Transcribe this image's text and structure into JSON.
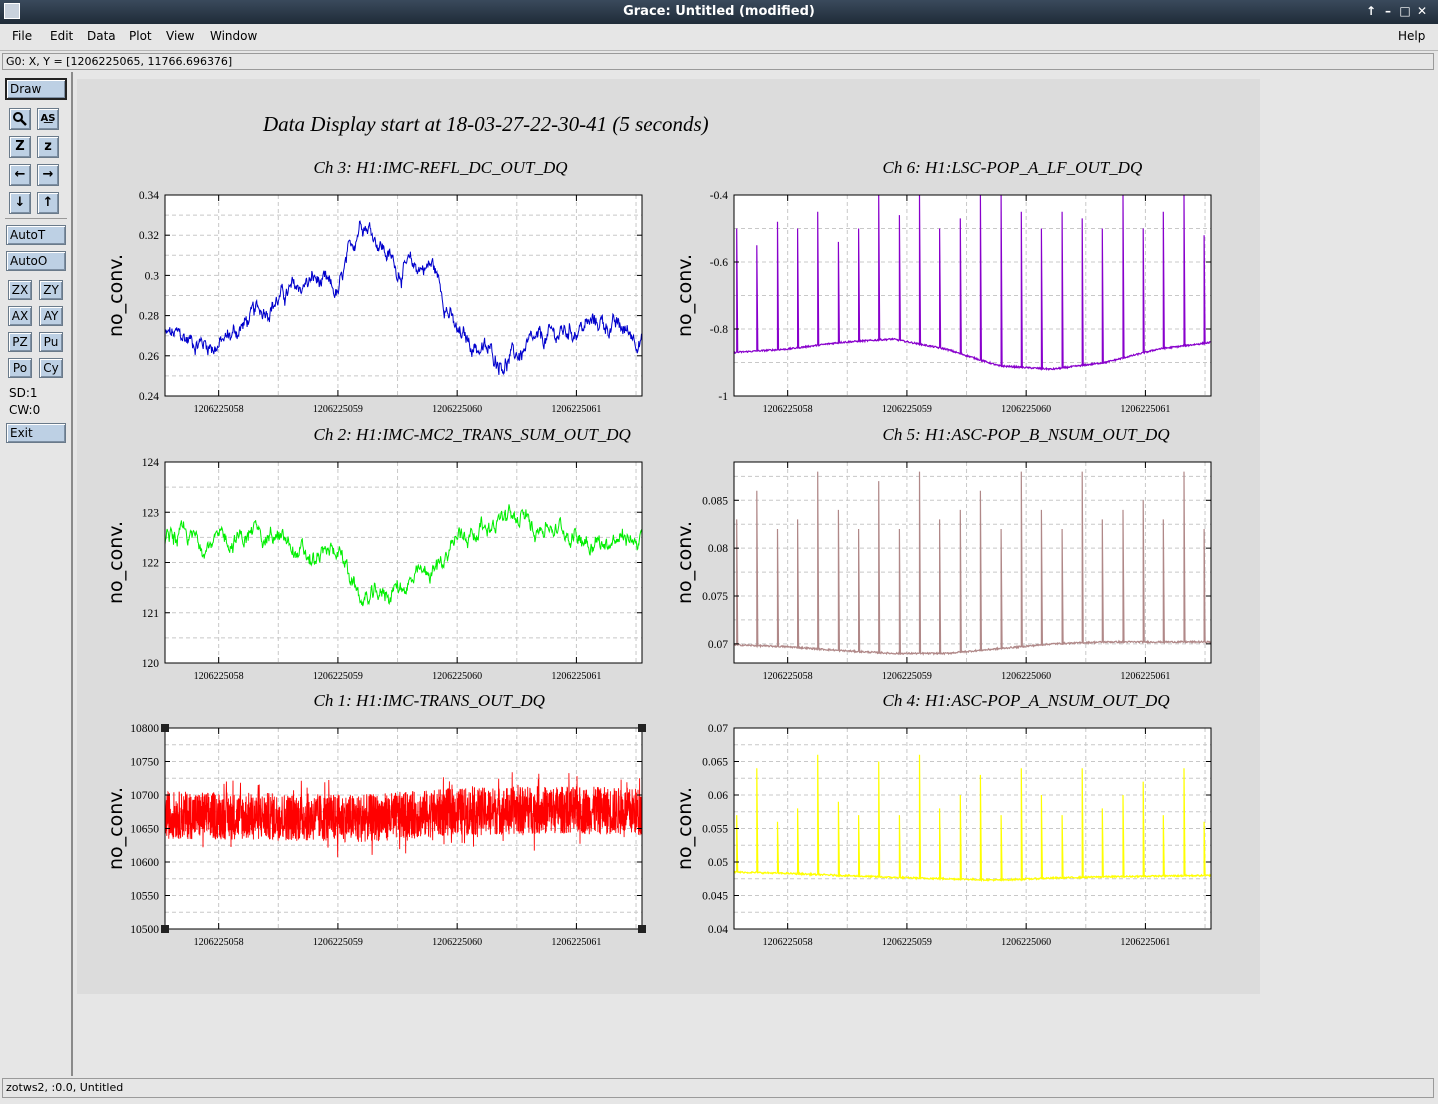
{
  "window": {
    "title": "Grace: Untitled (modified)",
    "controls": [
      "↑",
      "–",
      "□",
      "✕"
    ]
  },
  "menubar": {
    "items": [
      "File",
      "Edit",
      "Data",
      "Plot",
      "View",
      "Window"
    ],
    "help": "Help"
  },
  "locator": "G0: X, Y = [1206225065, 11766.696376]",
  "toolbar": {
    "draw": "Draw",
    "autot": "AutoT",
    "autoo": "AutoO",
    "zx": "ZX",
    "zy": "ZY",
    "ax": "AX",
    "ay": "AY",
    "pz": "PZ",
    "pu": "Pu",
    "po": "Po",
    "cy": "Cy",
    "sd": "SD:1",
    "cw": "CW:0",
    "exit": "Exit",
    "icons": [
      "zoom-icon",
      "text-icon",
      "autoscale-icon",
      "zoom-z-icon",
      "left-arrow-icon",
      "right-arrow-icon",
      "down-arrow-icon",
      "up-arrow-icon"
    ]
  },
  "statusbar": "zotws2, :0.0, Untitled",
  "chart_title": "Data Display start at 18-03-27-22-30-41 (5 seconds)",
  "chart_data": [
    {
      "type": "line",
      "title": "Ch 3: H1:IMC-REFL_DC_OUT_DQ",
      "ylabel": "no_conv.",
      "color": "#0000cc",
      "xticks": [
        "1206225058",
        "1206225059",
        "1206225060",
        "1206225061"
      ],
      "yticks": [
        "0.34",
        "0.32",
        "0.3",
        "0.28",
        "0.26",
        "0.24"
      ],
      "ylim": [
        0.24,
        0.34
      ],
      "x": [
        1206225057.6,
        1206225058.0,
        1206225058.4,
        1206225058.8,
        1206225059.0,
        1206225059.2,
        1206225059.5,
        1206225059.8,
        1206225060.0,
        1206225060.4,
        1206225060.8,
        1206225061.2,
        1206225061.6
      ],
      "values": [
        0.27,
        0.265,
        0.285,
        0.298,
        0.29,
        0.33,
        0.303,
        0.305,
        0.27,
        0.257,
        0.27,
        0.277,
        0.268
      ],
      "kind": "noise"
    },
    {
      "type": "line",
      "title": "Ch 6: H1:LSC-POP_A_LF_OUT_DQ",
      "ylabel": "no_conv.",
      "color": "#8800cc",
      "xticks": [
        "1206225058",
        "1206225059",
        "1206225060",
        "1206225061"
      ],
      "yticks": [
        "-0.4",
        "-0.6",
        "-0.8",
        "-1"
      ],
      "ylim": [
        -1.0,
        -0.4
      ],
      "baseline": [
        -0.87,
        -0.86,
        -0.84,
        -0.83,
        -0.86,
        -0.91,
        -0.92,
        -0.9,
        -0.86,
        -0.84
      ],
      "spike_tops": [
        -0.5,
        -0.55,
        -0.48,
        -0.5,
        -0.45,
        -0.54,
        -0.5,
        -0.4,
        -0.46,
        -0.4,
        -0.5,
        -0.47,
        -0.4,
        -0.4,
        -0.45,
        -0.5,
        -0.45,
        -0.47,
        -0.5,
        -0.4,
        -0.5,
        -0.45,
        -0.4,
        -0.52
      ],
      "kind": "spikes"
    },
    {
      "type": "line",
      "title": "Ch 2: H1:IMC-MC2_TRANS_SUM_OUT_DQ",
      "ylabel": "no_conv.",
      "color": "#00ee00",
      "xticks": [
        "1206225058",
        "1206225059",
        "1206225060",
        "1206225061"
      ],
      "yticks": [
        "124",
        "123",
        "122",
        "121",
        "120"
      ],
      "ylim": [
        120,
        124
      ],
      "x": [
        1206225057.6,
        1206225058.0,
        1206225058.4,
        1206225058.8,
        1206225059.0,
        1206225059.2,
        1206225059.5,
        1206225059.8,
        1206225060.0,
        1206225060.4,
        1206225060.8,
        1206225061.2,
        1206225061.6
      ],
      "values": [
        122.5,
        122.4,
        122.6,
        122.0,
        122.3,
        121.2,
        121.5,
        121.8,
        122.5,
        122.9,
        122.7,
        122.4,
        122.5
      ],
      "kind": "noise"
    },
    {
      "type": "line",
      "title": "Ch 5: H1:ASC-POP_B_NSUM_OUT_DQ",
      "ylabel": "no_conv.",
      "color": "#b08888",
      "xticks": [
        "1206225058",
        "1206225059",
        "1206225060",
        "1206225061"
      ],
      "yticks": [
        "0.085",
        "0.08",
        "0.075",
        "0.07"
      ],
      "ylim": [
        0.068,
        0.089
      ],
      "baseline": [
        0.0699,
        0.0697,
        0.0693,
        0.069,
        0.069,
        0.0695,
        0.07,
        0.0702,
        0.0702,
        0.0702
      ],
      "spike_tops": [
        0.083,
        0.086,
        0.082,
        0.083,
        0.088,
        0.084,
        0.082,
        0.087,
        0.082,
        0.088,
        0.083,
        0.084,
        0.086,
        0.082,
        0.088,
        0.084,
        0.082,
        0.088,
        0.083,
        0.084,
        0.085,
        0.083,
        0.088,
        0.082
      ],
      "kind": "spikes"
    },
    {
      "type": "line",
      "title": "Ch 1: H1:IMC-TRANS_OUT_DQ",
      "ylabel": "no_conv.",
      "color": "#ff0000",
      "xticks": [
        "1206225058",
        "1206225059",
        "1206225060",
        "1206225061"
      ],
      "yticks": [
        "10800",
        "10750",
        "10700",
        "10650",
        "10600",
        "10550",
        "10500"
      ],
      "ylim": [
        10500,
        10800
      ],
      "x": [
        1206225057.6,
        1206225058.4,
        1206225059.2,
        1206225060.0,
        1206225060.8,
        1206225061.6
      ],
      "values": [
        10670,
        10668,
        10665,
        10675,
        10678,
        10675
      ],
      "kind": "band"
    },
    {
      "type": "line",
      "title": "Ch 4: H1:ASC-POP_A_NSUM_OUT_DQ",
      "ylabel": "no_conv.",
      "color": "#ffff00",
      "xticks": [
        "1206225058",
        "1206225059",
        "1206225060",
        "1206225061"
      ],
      "yticks": [
        "0.07",
        "0.065",
        "0.06",
        "0.055",
        "0.05",
        "0.045",
        "0.04"
      ],
      "ylim": [
        0.04,
        0.07
      ],
      "baseline": [
        0.0485,
        0.0483,
        0.048,
        0.0477,
        0.0475,
        0.0473,
        0.0476,
        0.0478,
        0.0479,
        0.048
      ],
      "spike_tops": [
        0.057,
        0.064,
        0.056,
        0.058,
        0.066,
        0.059,
        0.057,
        0.065,
        0.057,
        0.066,
        0.058,
        0.06,
        0.063,
        0.057,
        0.064,
        0.06,
        0.057,
        0.064,
        0.058,
        0.06,
        0.062,
        0.057,
        0.064,
        0.056
      ],
      "kind": "spikes"
    }
  ]
}
